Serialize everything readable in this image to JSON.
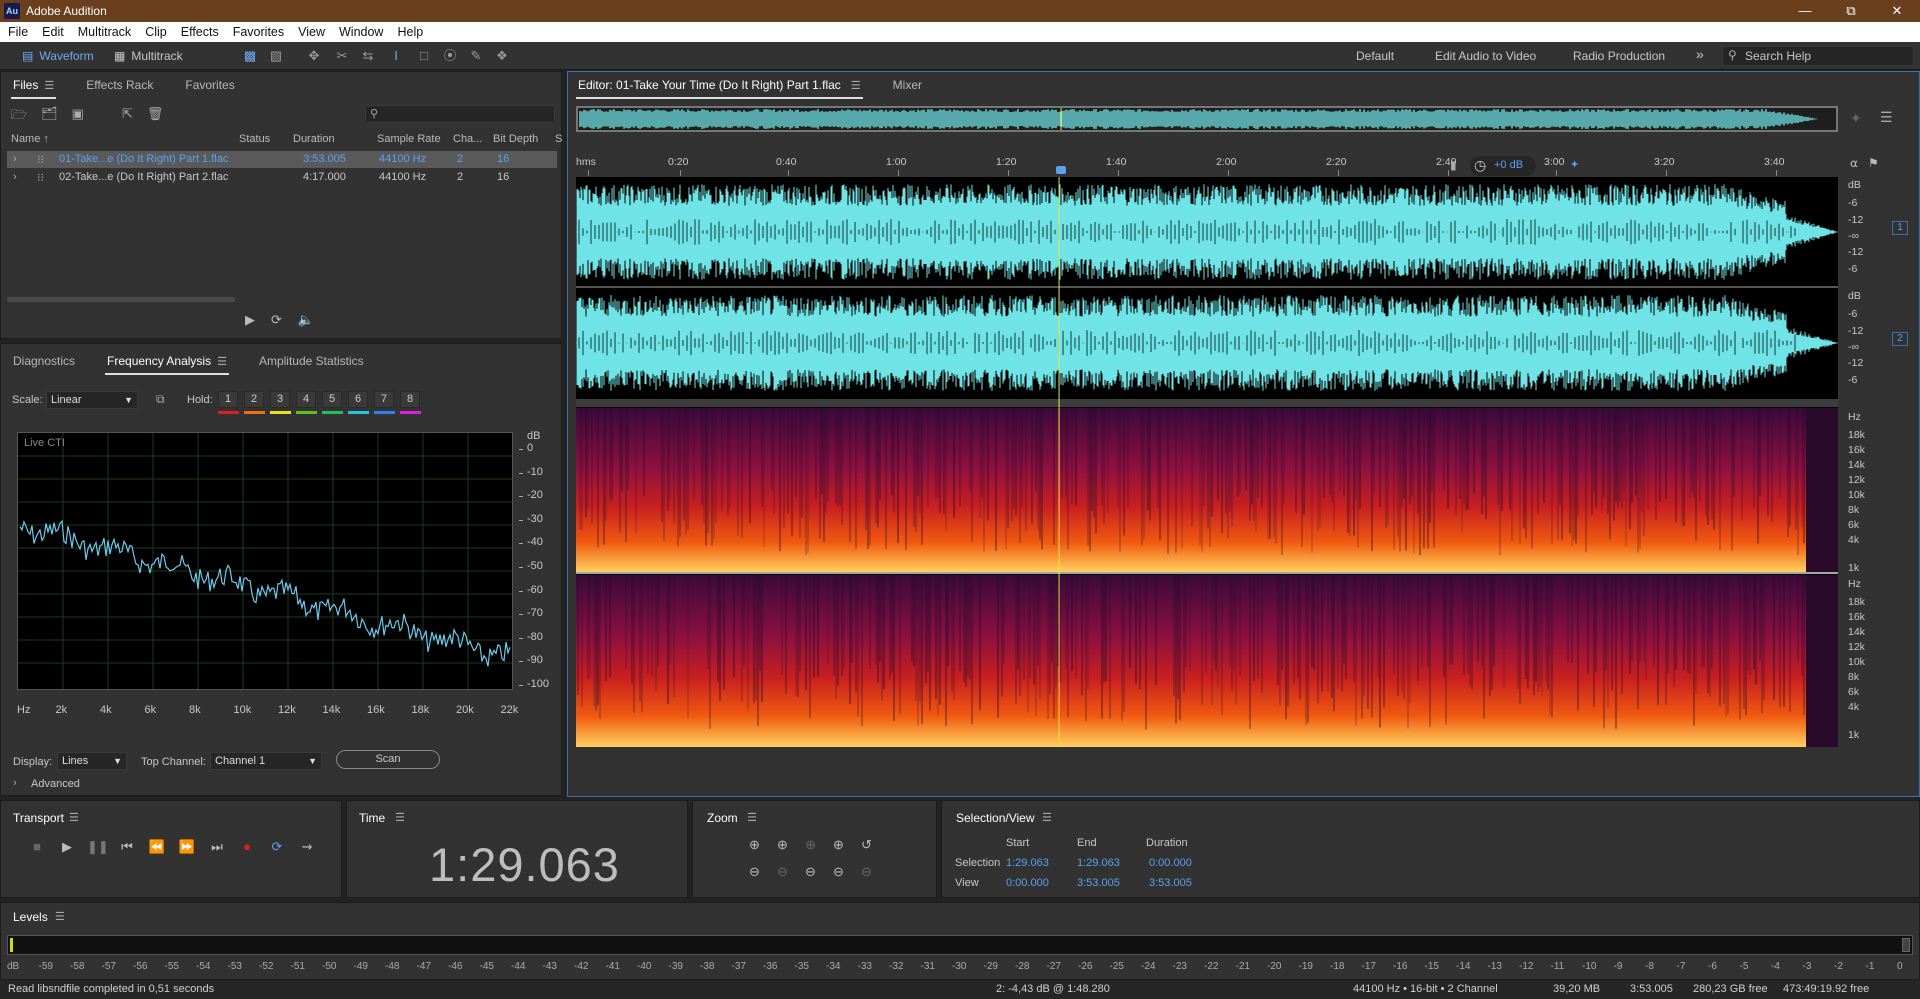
{
  "app": {
    "title": "Adobe Audition",
    "logo": "Au"
  },
  "menu": [
    "File",
    "Edit",
    "Multitrack",
    "Clip",
    "Effects",
    "Favorites",
    "View",
    "Window",
    "Help"
  ],
  "toolbar": {
    "waveform_label": "Waveform",
    "multitrack_label": "Multitrack",
    "workspaces": [
      "Default",
      "Edit Audio to Video",
      "Radio Production"
    ],
    "search_placeholder": "Search Help"
  },
  "files_panel": {
    "tabs": [
      "Files",
      "Effects Rack",
      "Favorites"
    ],
    "columns": [
      "Name ↑",
      "Status",
      "Duration",
      "Sample Rate",
      "Cha...",
      "Bit Depth",
      "S"
    ],
    "rows": [
      {
        "name": "01-Take...e (Do It Right) Part 1.flac",
        "duration": "3:53.005",
        "sample_rate": "44100 Hz",
        "channels": "2",
        "bit_depth": "16",
        "selected": true
      },
      {
        "name": "02-Take...e (Do It Right) Part 2.flac",
        "duration": "4:17.000",
        "sample_rate": "44100 Hz",
        "channels": "2",
        "bit_depth": "16",
        "selected": false
      }
    ]
  },
  "analysis_panel": {
    "tabs": [
      "Diagnostics",
      "Frequency Analysis",
      "Amplitude Statistics"
    ],
    "scale_label": "Scale:",
    "scale_value": "Linear",
    "hold_label": "Hold:",
    "hold_buttons": [
      "1",
      "2",
      "3",
      "4",
      "5",
      "6",
      "7",
      "8"
    ],
    "hold_colors": [
      "#e02020",
      "#f07010",
      "#e8e020",
      "#60c020",
      "#20c060",
      "#20c8d8",
      "#3080f0",
      "#e020e0"
    ],
    "live_cti": "Live CTI",
    "db_unit": "dB",
    "db_ticks": [
      "0",
      "-10",
      "-20",
      "-30",
      "-40",
      "-50",
      "-60",
      "-70",
      "-80",
      "-90",
      "-100"
    ],
    "hz_ticks": [
      "Hz",
      "2k",
      "4k",
      "6k",
      "8k",
      "10k",
      "12k",
      "14k",
      "16k",
      "18k",
      "20k",
      "22k"
    ],
    "display_label": "Display:",
    "display_value": "Lines",
    "top_channel_label": "Top Channel:",
    "top_channel_value": "Channel 1",
    "scan_label": "Scan",
    "advanced_label": "Advanced"
  },
  "editor": {
    "tab_label": "Editor: 01-Take Your Time (Do It Right) Part 1.flac",
    "mixer_label": "Mixer",
    "ruler": [
      "hms",
      "0:20",
      "0:40",
      "1:00",
      "1:20",
      "1:40",
      "2:00",
      "2:20",
      "2:40",
      "3:00",
      "3:20",
      "3:40"
    ],
    "volume": "+0 dB",
    "db_labels": [
      "dB",
      "-6",
      "-12",
      "-∞",
      "-12",
      "-6"
    ],
    "channel_badges": [
      "1",
      "2"
    ],
    "hz_labels": [
      "Hz",
      "18k",
      "16k",
      "14k",
      "12k",
      "10k",
      "8k",
      "6k",
      "4k",
      "1k"
    ],
    "playhead_fraction": 0.384
  },
  "transport": {
    "title": "Transport"
  },
  "time": {
    "title": "Time",
    "value": "1:29.063"
  },
  "zoom": {
    "title": "Zoom"
  },
  "selection_view": {
    "title": "Selection/View",
    "headers": [
      "Start",
      "End",
      "Duration"
    ],
    "selection_label": "Selection",
    "selection": [
      "1:29.063",
      "1:29.063",
      "0:00.000"
    ],
    "view_label": "View",
    "view": [
      "0:00.000",
      "3:53.005",
      "3:53.005"
    ]
  },
  "levels": {
    "title": "Levels",
    "scale": [
      "dB",
      "-59",
      "-58",
      "-57",
      "-56",
      "-55",
      "-54",
      "-53",
      "-52",
      "-51",
      "-50",
      "-49",
      "-48",
      "-47",
      "-46",
      "-45",
      "-44",
      "-43",
      "-42",
      "-41",
      "-40",
      "-39",
      "-38",
      "-37",
      "-36",
      "-35",
      "-34",
      "-33",
      "-32",
      "-31",
      "-30",
      "-29",
      "-28",
      "-27",
      "-26",
      "-25",
      "-24",
      "-23",
      "-22",
      "-21",
      "-20",
      "-19",
      "-18",
      "-17",
      "-16",
      "-15",
      "-14",
      "-13",
      "-12",
      "-11",
      "-10",
      "-9",
      "-8",
      "-7",
      "-6",
      "-5",
      "-4",
      "-3",
      "-2",
      "-1",
      "0"
    ]
  },
  "status": {
    "message": "Read libsndfile completed in 0,51 seconds",
    "cursor": "2: -4,43 dB @ 1:48.280",
    "format": "44100 Hz • 16-bit • 2 Channel",
    "size": "39,20 MB",
    "duration": "3:53.005",
    "free": "280,23 GB free",
    "free_time": "473:49:19.92 free"
  },
  "colors": {
    "waveform": "#6fe3e6",
    "accent": "#5aa0f0",
    "playhead": "#e8e840",
    "titlebar": "#6a3f1d"
  }
}
